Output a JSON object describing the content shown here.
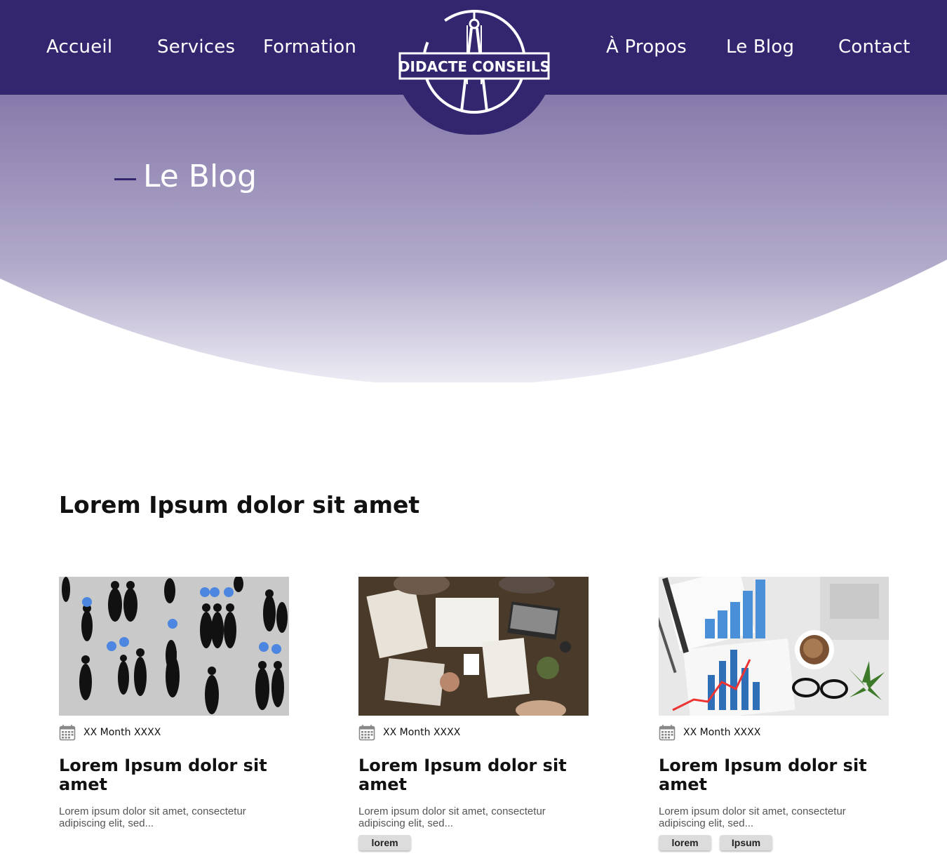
{
  "brand": {
    "name": "DIDACTE CONSEILS",
    "primary_color": "#34256f"
  },
  "nav": {
    "left": [
      {
        "label": "Accueil"
      },
      {
        "label": "Services"
      },
      {
        "label": "Formation"
      }
    ],
    "right": [
      {
        "label": "À Propos"
      },
      {
        "label": "Le Blog"
      },
      {
        "label": "Contact"
      }
    ]
  },
  "hero": {
    "title": "Le Blog"
  },
  "section": {
    "title": "Lorem Ipsum dolor sit amet"
  },
  "posts": [
    {
      "image": "business-people-silhouettes",
      "date": "XX Month XXXX",
      "title": "Lorem Ipsum dolor sit amet",
      "excerpt": "Lorem ipsum dolor sit amet, consectetur adipiscing elit, sed...",
      "tags": []
    },
    {
      "image": "team-desk-overhead",
      "date": "XX Month XXXX",
      "title": "Lorem Ipsum dolor sit amet",
      "excerpt": "Lorem ipsum dolor sit amet, consectetur adipiscing elit, sed...",
      "tags": [
        "lorem"
      ]
    },
    {
      "image": "charts-coffee-desk",
      "date": "XX Month XXXX",
      "title": "Lorem Ipsum dolor sit amet",
      "excerpt": "Lorem ipsum dolor sit amet, consectetur adipiscing elit, sed...",
      "tags": [
        "lorem",
        "Ipsum"
      ]
    }
  ],
  "icons": {
    "date": "calendar-icon"
  }
}
